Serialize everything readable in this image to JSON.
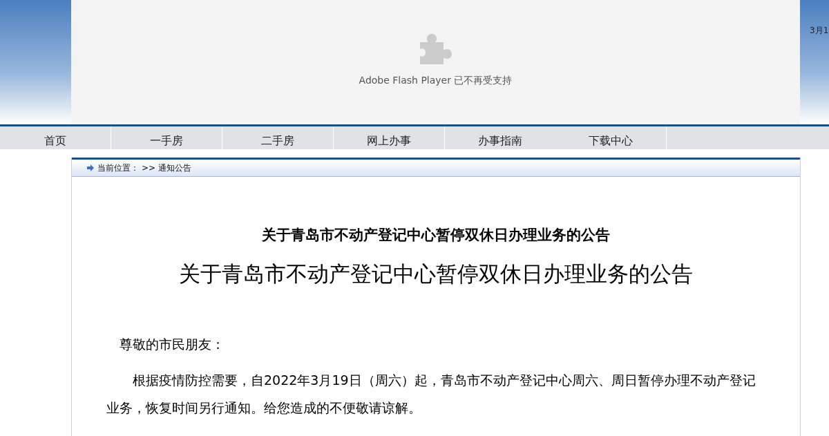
{
  "header": {
    "flash_notice": "Adobe Flash Player 已不再受支持",
    "side_text": "3月1"
  },
  "nav": [
    {
      "label": "首页"
    },
    {
      "label": "一手房"
    },
    {
      "label": "二手房"
    },
    {
      "label": "网上办事"
    },
    {
      "label": "办事指南"
    },
    {
      "label": "下载中心"
    }
  ],
  "breadcrumb": {
    "label": "当前位置：",
    "path": ">> 通知公告"
  },
  "article": {
    "heading": "关于青岛市不动产登记中心暂停双休日办理业务的公告",
    "title": "关于青岛市不动产登记中心暂停双休日办理业务的公告",
    "paragraphs": [
      "尊敬的市民朋友：",
      "根据疫情防控需要，自2022年3月19日（周六）起，青岛市不动产登记中心周六、周日暂停办理不动产登记业务，恢复时间另行通知。给您造成的不便敬请谅解。"
    ]
  }
}
